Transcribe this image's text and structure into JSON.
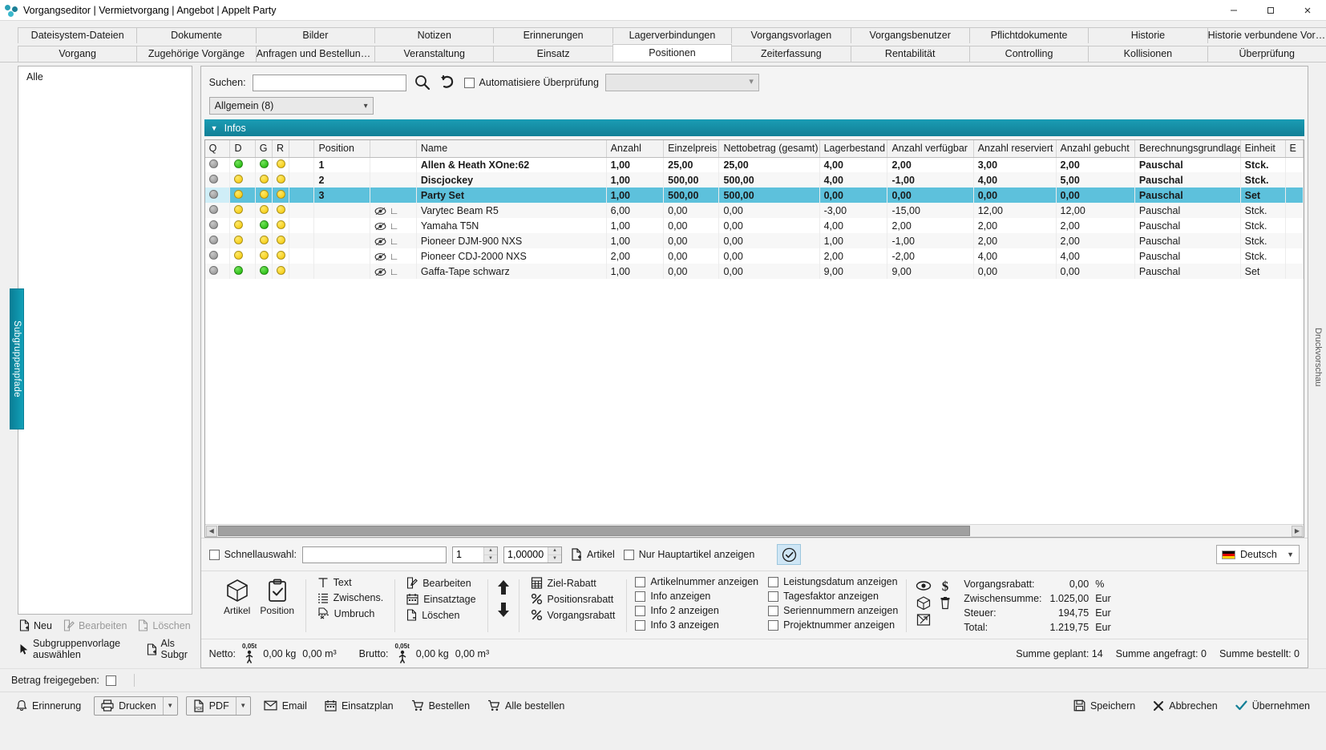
{
  "window": {
    "title": "Vorgangseditor | Vermietvorgang | Angebot | Appelt Party",
    "minimize": "–",
    "maximize": "❐",
    "close": "✕"
  },
  "tabs_row1": [
    "Dateisystem-Dateien",
    "Dokumente",
    "Bilder",
    "Notizen",
    "Erinnerungen",
    "Lagerverbindungen",
    "Vorgangsvorlagen",
    "Vorgangsbenutzer",
    "Pflichtdokumente",
    "Historie",
    "Historie verbundene Vorgänge"
  ],
  "tabs_row2": [
    "Vorgang",
    "Zugehörige Vorgänge",
    "Anfragen und Bestellungen",
    "Veranstaltung",
    "Einsatz",
    "Positionen",
    "Zeiterfassung",
    "Rentabilität",
    "Controlling",
    "Kollisionen",
    "Überprüfung"
  ],
  "active_tab_row2": "Positionen",
  "left_panel": {
    "vertical_tab": "Subgruppenpfade",
    "entries": [
      "Alle"
    ],
    "actions_row1": [
      {
        "label": "Neu",
        "icon": "new-document-icon",
        "disabled": false
      },
      {
        "label": "Bearbeiten",
        "icon": "edit-icon",
        "disabled": true
      },
      {
        "label": "Löschen",
        "icon": "delete-document-icon",
        "disabled": true
      }
    ],
    "actions_row2": [
      {
        "label": "Subgruppenvorlage auswählen",
        "icon": "cursor-icon",
        "disabled": false
      },
      {
        "label": "Als Subgr",
        "icon": "new-document-icon",
        "disabled": false
      }
    ]
  },
  "right_vertical_tab": "Druckvorschau",
  "search": {
    "label": "Suchen:",
    "value": "",
    "placeholder": "",
    "search_icon": "search-icon",
    "undo_icon": "undo-icon",
    "auto_check_label": "Automatisiere Überprüfung",
    "auto_check_checked": false
  },
  "group_combo": {
    "value": "Allgemein (8)"
  },
  "infos_header": {
    "label": "Infos",
    "expanded": true
  },
  "grid": {
    "columns": [
      "Q",
      "D",
      "G",
      "R",
      "",
      "Position",
      "",
      "Name",
      "Anzahl",
      "Einzelpreis",
      "Nettobetrag (gesamt)",
      "Lagerbestand",
      "Anzahl verfügbar",
      "Anzahl reserviert",
      "Anzahl gebucht",
      "Berechnungsgrundlage",
      "Einheit",
      "E"
    ],
    "rows": [
      {
        "q": "gray",
        "d": "green",
        "g": "green",
        "r": "yellow",
        "position": "1",
        "sub": false,
        "name": "Allen & Heath XOne:62",
        "anzahl": "1,00",
        "einzelpreis": "25,00",
        "netto": "25,00",
        "lagerbestand": "4,00",
        "verfuegbar": "2,00",
        "reserviert": "3,00",
        "gebucht": "2,00",
        "berechnung": "Pauschal",
        "einheit": "Stck.",
        "bold": true
      },
      {
        "q": "gray",
        "d": "yellow",
        "g": "yellow",
        "r": "yellow",
        "position": "2",
        "sub": false,
        "name": "Discjockey",
        "anzahl": "1,00",
        "einzelpreis": "500,00",
        "netto": "500,00",
        "lagerbestand": "4,00",
        "verfuegbar": "-1,00",
        "reserviert": "4,00",
        "gebucht": "5,00",
        "berechnung": "Pauschal",
        "einheit": "Stck.",
        "bold": true
      },
      {
        "q": "gray",
        "d": "yellow",
        "g": "yellow",
        "r": "yellow",
        "position": "3",
        "sub": false,
        "name": "Party Set",
        "anzahl": "1,00",
        "einzelpreis": "500,00",
        "netto": "500,00",
        "lagerbestand": "0,00",
        "verfuegbar": "0,00",
        "reserviert": "0,00",
        "gebucht": "0,00",
        "berechnung": "Pauschal",
        "einheit": "Set",
        "bold": true,
        "selected": true
      },
      {
        "q": "gray",
        "d": "yellow",
        "g": "yellow",
        "r": "yellow",
        "position": "",
        "sub": true,
        "name": "Varytec Beam R5",
        "anzahl": "6,00",
        "einzelpreis": "0,00",
        "netto": "0,00",
        "lagerbestand": "-3,00",
        "verfuegbar": "-15,00",
        "reserviert": "12,00",
        "gebucht": "12,00",
        "berechnung": "Pauschal",
        "einheit": "Stck.",
        "bold": false
      },
      {
        "q": "gray",
        "d": "yellow",
        "g": "green",
        "r": "yellow",
        "position": "",
        "sub": true,
        "name": "Yamaha T5N",
        "anzahl": "1,00",
        "einzelpreis": "0,00",
        "netto": "0,00",
        "lagerbestand": "4,00",
        "verfuegbar": "2,00",
        "reserviert": "2,00",
        "gebucht": "2,00",
        "berechnung": "Pauschal",
        "einheit": "Stck.",
        "bold": false
      },
      {
        "q": "gray",
        "d": "yellow",
        "g": "yellow",
        "r": "yellow",
        "position": "",
        "sub": true,
        "name": "Pioneer DJM-900 NXS",
        "anzahl": "1,00",
        "einzelpreis": "0,00",
        "netto": "0,00",
        "lagerbestand": "1,00",
        "verfuegbar": "-1,00",
        "reserviert": "2,00",
        "gebucht": "2,00",
        "berechnung": "Pauschal",
        "einheit": "Stck.",
        "bold": false
      },
      {
        "q": "gray",
        "d": "yellow",
        "g": "yellow",
        "r": "yellow",
        "position": "",
        "sub": true,
        "name": "Pioneer CDJ-2000 NXS",
        "anzahl": "2,00",
        "einzelpreis": "0,00",
        "netto": "0,00",
        "lagerbestand": "2,00",
        "verfuegbar": "-2,00",
        "reserviert": "4,00",
        "gebucht": "4,00",
        "berechnung": "Pauschal",
        "einheit": "Stck.",
        "bold": false
      },
      {
        "q": "gray",
        "d": "green",
        "g": "green",
        "r": "yellow",
        "position": "",
        "sub": true,
        "name": "Gaffa-Tape schwarz",
        "anzahl": "1,00",
        "einzelpreis": "0,00",
        "netto": "0,00",
        "lagerbestand": "9,00",
        "verfuegbar": "9,00",
        "reserviert": "0,00",
        "gebucht": "0,00",
        "berechnung": "Pauschal",
        "einheit": "Set",
        "bold": false
      }
    ]
  },
  "quick_row": {
    "checkbox_label": "Schnellauswahl:",
    "checkbox_checked": false,
    "text_value": "",
    "count_value": "1",
    "factor_value": "1,00000",
    "artikel_label": "Artikel",
    "artikel_icon": "add-document-icon",
    "nur_haupt_label": "Nur Hauptartikel anzeigen",
    "nur_haupt_checked": false,
    "confirm_icon": "check-circle-icon",
    "language": "Deutsch",
    "language_flag": "flag-de-icon"
  },
  "toolbar": {
    "big_buttons": [
      {
        "label": "Artikel",
        "icon": "cube-icon"
      },
      {
        "label": "Position",
        "icon": "clipboard-check-icon"
      }
    ],
    "group_text": [
      {
        "label": "Text",
        "icon": "text-icon"
      },
      {
        "label": "Zwischens.",
        "icon": "subtotal-icon"
      },
      {
        "label": "Umbruch",
        "icon": "page-break-icon"
      }
    ],
    "group_edit": [
      {
        "label": "Bearbeiten",
        "icon": "edit-icon"
      },
      {
        "label": "Einsatztage",
        "icon": "calendar-icon"
      },
      {
        "label": "Löschen",
        "icon": "delete-document-icon"
      }
    ],
    "arrows": [
      {
        "icon": "arrow-up-icon"
      },
      {
        "icon": "arrow-down-icon"
      }
    ],
    "group_discount": [
      {
        "label": "Ziel-Rabatt",
        "icon": "calculator-icon"
      },
      {
        "label": "Positionsrabatt",
        "icon": "percent-icon"
      },
      {
        "label": "Vorgangsrabatt",
        "icon": "percent-icon"
      }
    ],
    "checkboxes_col1": [
      {
        "label": "Artikelnummer anzeigen",
        "checked": false
      },
      {
        "label": "Info anzeigen",
        "checked": false
      },
      {
        "label": "Info 2 anzeigen",
        "checked": false
      },
      {
        "label": "Info 3 anzeigen",
        "checked": false
      }
    ],
    "checkboxes_col2": [
      {
        "label": "Leistungsdatum anzeigen",
        "checked": false
      },
      {
        "label": "Tagesfaktor anzeigen",
        "checked": false
      },
      {
        "label": "Seriennummern anzeigen",
        "checked": false
      },
      {
        "label": "Projektnummer anzeigen",
        "checked": false
      }
    ],
    "total_icons": [
      "eye-icon",
      "dollar-icon",
      "cube-icon",
      "trash-icon",
      "box-arrow-icon"
    ],
    "totals": [
      {
        "key": "Vorgangsrabatt:",
        "value": "0,00",
        "unit": "%"
      },
      {
        "key": "Zwischensumme:",
        "value": "1.025,00",
        "unit": "Eur"
      },
      {
        "key": "Steuer:",
        "value": "194,75",
        "unit": "Eur"
      },
      {
        "key": "Total:",
        "value": "1.219,75",
        "unit": "Eur"
      }
    ]
  },
  "weights": {
    "netto_label": "Netto:",
    "netto_fig": "0,05t",
    "netto_kg": "0,00 kg",
    "netto_m3": "0,00 m³",
    "brutto_label": "Brutto:",
    "brutto_fig": "0,05t",
    "brutto_kg": "0,00 kg",
    "brutto_m3": "0,00 m³",
    "summary": [
      "Summe geplant: 14",
      "Summe angefragt: 0",
      "Summe bestellt: 0"
    ]
  },
  "betrag": {
    "label": "Betrag freigegeben:",
    "checked": false
  },
  "footer": {
    "left": [
      {
        "label": "Erinnerung",
        "icon": "bell-icon"
      },
      {
        "label": "Drucken",
        "icon": "printer-icon",
        "split": true
      },
      {
        "label": "PDF",
        "icon": "pdf-icon",
        "split": true
      },
      {
        "label": "Email",
        "icon": "mail-icon"
      },
      {
        "label": "Einsatzplan",
        "icon": "calendar-icon"
      },
      {
        "label": "Bestellen",
        "icon": "cart-icon"
      },
      {
        "label": "Alle bestellen",
        "icon": "cart-icon"
      }
    ],
    "right": [
      {
        "label": "Speichern",
        "icon": "save-icon"
      },
      {
        "label": "Abbrechen",
        "icon": "cancel-x-icon"
      },
      {
        "label": "Übernehmen",
        "icon": "check-icon"
      }
    ]
  },
  "colors": {
    "accent_teal": "#127f96",
    "selection_blue": "#5dc1dc",
    "lamp_green": "#16b300",
    "lamp_yellow": "#f2c500",
    "lamp_gray": "#8e8e8e"
  }
}
